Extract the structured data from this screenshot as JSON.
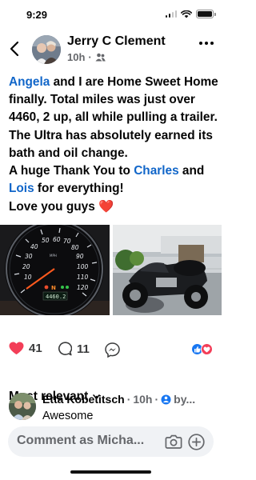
{
  "status_bar": {
    "time": "9:29"
  },
  "post": {
    "author": "Jerry C Clement",
    "time": "10h",
    "body": [
      {
        "text": "Angela",
        "mention": true
      },
      {
        "text": " and I are Home Sweet Home finally. Total miles was just over 4460, 2 up, all while pulling a trailer. The Ultra has absolutely earned its bath and oil change.",
        "mention": false
      },
      {
        "text": "\nA huge Thank You to ",
        "mention": false
      },
      {
        "text": "Charles",
        "mention": true
      },
      {
        "text": " and ",
        "mention": false
      },
      {
        "text": "Lois",
        "mention": true
      },
      {
        "text": " for everything!\nLove you guys ",
        "mention": false
      }
    ],
    "heart_emoji": "❤️",
    "odometer_reading": "4460.2"
  },
  "reactions": {
    "likes": "41",
    "comments": "11"
  },
  "comments_section": {
    "sort_label": "Most relevant",
    "first_comment": {
      "name": "Etta Kobetitsch",
      "time": "10h",
      "by_label": "by...",
      "text": "Awesome"
    }
  },
  "composer": {
    "placeholder": "Comment as Micha..."
  },
  "colors": {
    "mention": "#1166c9",
    "like_blue": "#1877f2",
    "heart_red": "#f33e58"
  }
}
